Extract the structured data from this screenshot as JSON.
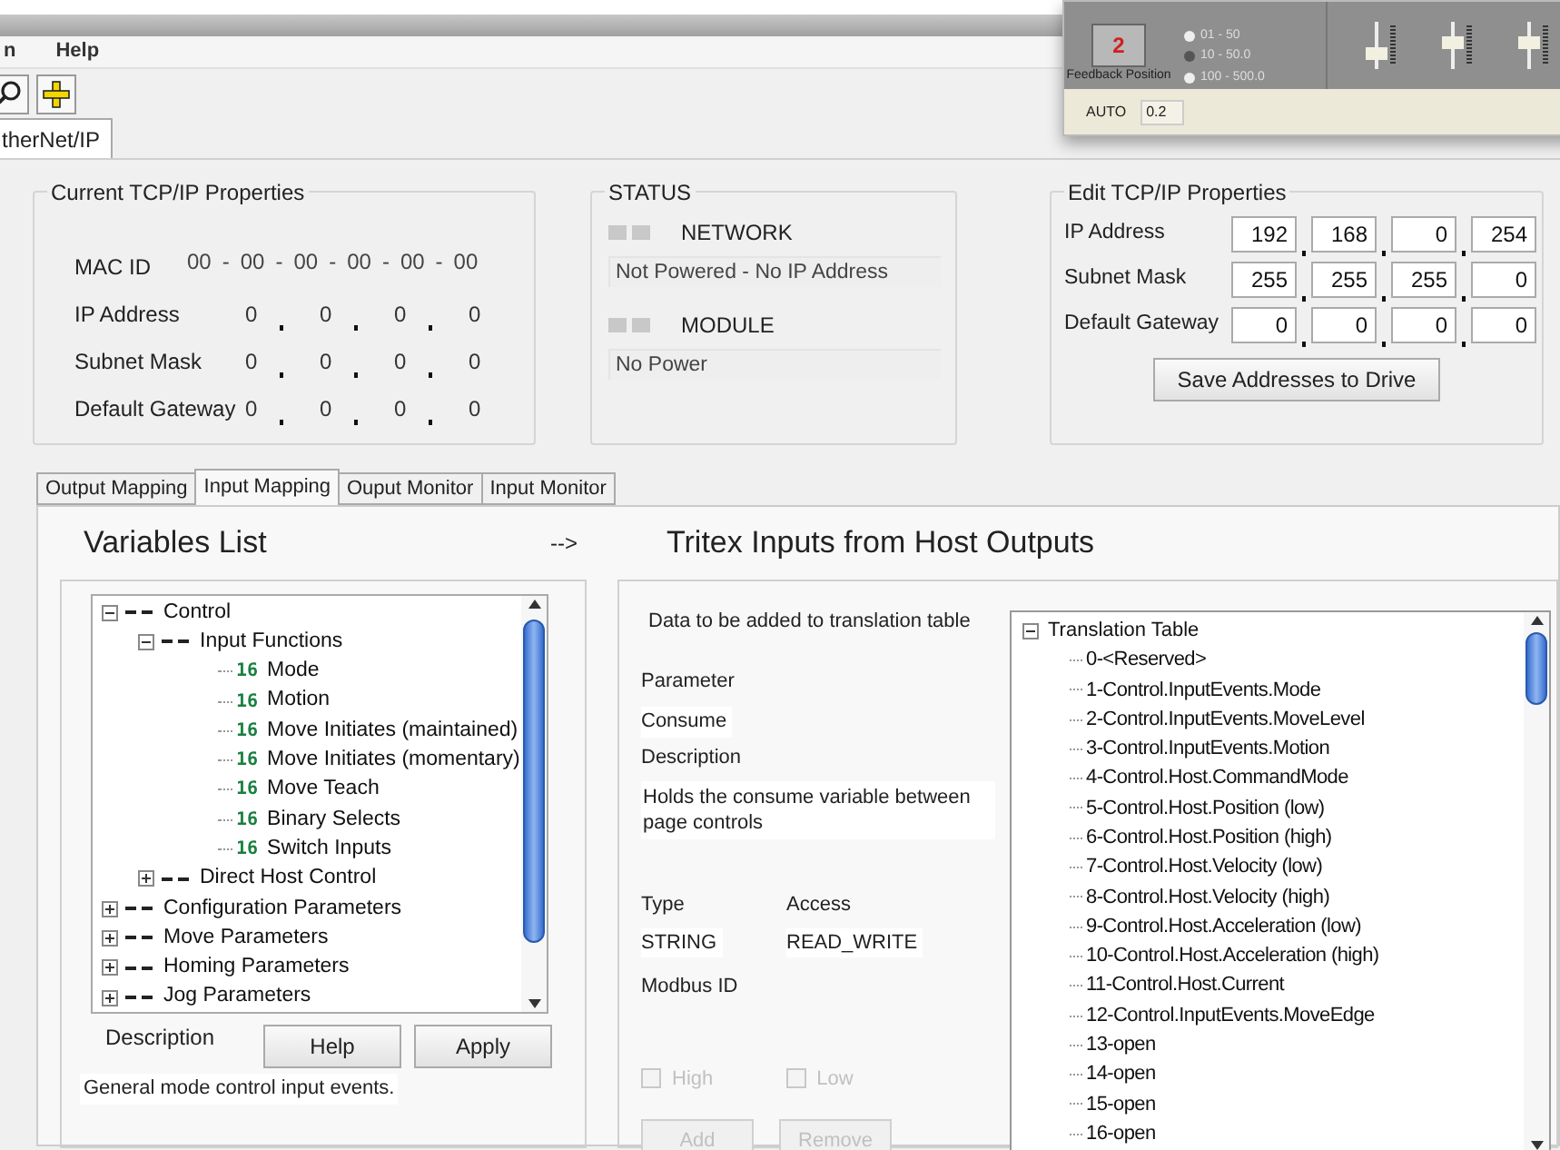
{
  "overlay_window": {
    "counter_button": "2",
    "counter_caption": "Feedback Position",
    "ranges": [
      {
        "label": "01 - 50",
        "selected": false
      },
      {
        "label": "10 - 50.0",
        "selected": true
      },
      {
        "label": "100 - 500.0",
        "selected": false
      }
    ],
    "mode": "AUTO",
    "value": "0.2"
  },
  "menu": [
    "n",
    "Help"
  ],
  "main_tab": {
    "label": "therNet/IP",
    "selected": true
  },
  "current_tcpip": {
    "title": "Current TCP/IP Properties",
    "mac": {
      "label": "MAC ID",
      "separator": "-",
      "octets": [
        "00",
        "00",
        "00",
        "00",
        "00",
        "00"
      ]
    },
    "rows": [
      {
        "label": "IP Address",
        "octets": [
          "0",
          "0",
          "0",
          "0"
        ]
      },
      {
        "label": "Subnet Mask",
        "octets": [
          "0",
          "0",
          "0",
          "0"
        ]
      },
      {
        "label": "Default Gateway",
        "octets": [
          "0",
          "0",
          "0",
          "0"
        ]
      }
    ]
  },
  "status": {
    "title": "STATUS",
    "items": [
      {
        "label": "NETWORK",
        "message": "Not Powered - No IP Address"
      },
      {
        "label": "MODULE",
        "message": "No Power"
      }
    ]
  },
  "edit_tcpip": {
    "title": "Edit TCP/IP Properties",
    "rows": [
      {
        "label": "IP Address",
        "octets": [
          "192",
          "168",
          "0",
          "254"
        ]
      },
      {
        "label": "Subnet Mask",
        "octets": [
          "255",
          "255",
          "255",
          "0"
        ]
      },
      {
        "label": "Default Gateway",
        "octets": [
          "0",
          "0",
          "0",
          "0"
        ]
      }
    ],
    "save_button": "Save Addresses to Drive"
  },
  "tabs": [
    {
      "label": "Output Mapping",
      "selected": false
    },
    {
      "label": "Input Mapping",
      "selected": true
    },
    {
      "label": "Ouput Monitor",
      "selected": false
    },
    {
      "label": "Input Monitor",
      "selected": false
    }
  ],
  "variables": {
    "title": "Variables List",
    "arrow": "-->",
    "tree": [
      {
        "label": "Control",
        "kind": "group",
        "expanded": true,
        "children": [
          {
            "label": "Input Functions",
            "kind": "group",
            "expanded": true,
            "children": [
              {
                "label": "Mode",
                "kind": "variable",
                "badge": "16"
              },
              {
                "label": "Motion",
                "kind": "variable",
                "badge": "16"
              },
              {
                "label": "Move Initiates (maintained)",
                "kind": "variable",
                "badge": "16"
              },
              {
                "label": "Move Initiates (momentary)",
                "kind": "variable",
                "badge": "16"
              },
              {
                "label": "Move Teach",
                "kind": "variable",
                "badge": "16"
              },
              {
                "label": "Binary Selects",
                "kind": "variable",
                "badge": "16"
              },
              {
                "label": "Switch Inputs",
                "kind": "variable",
                "badge": "16"
              }
            ]
          },
          {
            "label": "Direct Host Control",
            "kind": "group",
            "expanded": false
          }
        ]
      },
      {
        "label": "Configuration Parameters",
        "kind": "group",
        "expanded": false
      },
      {
        "label": "Move Parameters",
        "kind": "group",
        "expanded": false
      },
      {
        "label": "Homing Parameters",
        "kind": "group",
        "expanded": false
      },
      {
        "label": "Jog Parameters",
        "kind": "group",
        "expanded": false
      }
    ],
    "description_label": "Description",
    "help_button": "Help",
    "apply_button": "Apply",
    "description": "General mode control input events."
  },
  "inputs": {
    "title": "Tritex Inputs from Host Outputs",
    "hint": "Data to be added to translation table",
    "parameter_label": "Parameter",
    "parameter": "Consume",
    "description_label": "Description",
    "description": "Holds the consume variable between page controls",
    "type_label": "Type",
    "type": "STRING",
    "access_label": "Access",
    "access": "READ_WRITE",
    "modbus_label": "Modbus ID",
    "options": [
      {
        "label": "High",
        "checked": false,
        "disabled": true
      },
      {
        "label": "Low",
        "checked": false,
        "disabled": true
      }
    ],
    "buttons": [
      {
        "label": "Add",
        "disabled": true
      },
      {
        "label": "Remove",
        "disabled": true
      }
    ],
    "translation_table": {
      "label": "Translation Table",
      "expanded": true,
      "children": [
        "0-<Reserved>",
        "1-Control.InputEvents.Mode",
        "2-Control.InputEvents.MoveLevel",
        "3-Control.InputEvents.Motion",
        "4-Control.Host.CommandMode",
        "5-Control.Host.Position (low)",
        "6-Control.Host.Position (high)",
        "7-Control.Host.Velocity (low)",
        "8-Control.Host.Velocity (high)",
        "9-Control.Host.Acceleration (low)",
        "10-Control.Host.Acceleration (high)",
        "11-Control.Host.Current",
        "12-Control.InputEvents.MoveEdge",
        "13-open",
        "14-open",
        "15-open",
        "16-open"
      ]
    }
  }
}
